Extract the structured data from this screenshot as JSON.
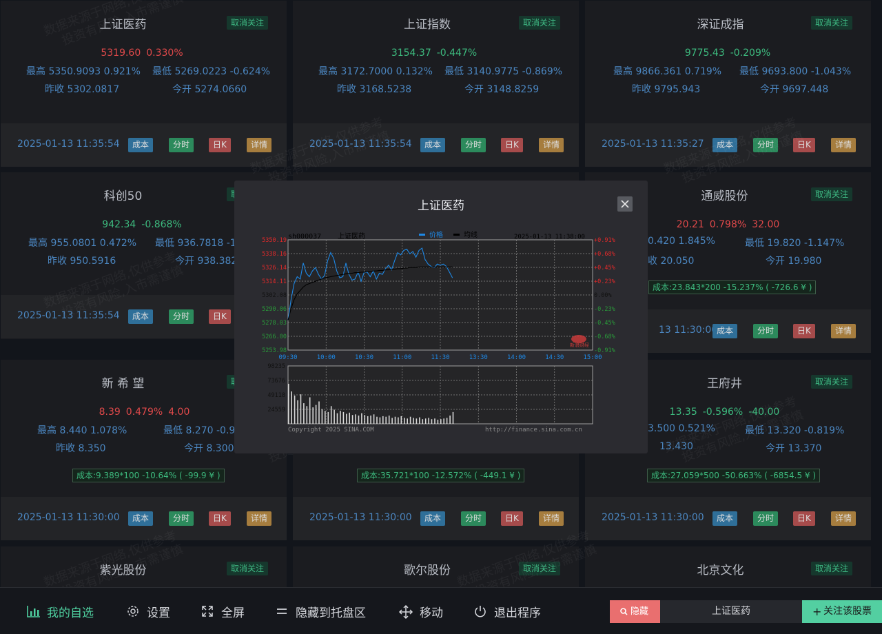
{
  "cards": [
    {
      "name": "上证医药",
      "action": "取消关注",
      "price": "5319.60",
      "pct": "0.330%",
      "extra": "",
      "dir": "up",
      "high": "最高 5350.9093 0.921%",
      "low": "最低 5269.0223 -0.624%",
      "prev": "昨收 5302.0817",
      "open": "今开 5274.0660",
      "cost": "",
      "time": "2025-01-13 11:35:54"
    },
    {
      "name": "上证指数",
      "action": "取消关注",
      "price": "3154.37",
      "pct": "-0.447%",
      "extra": "",
      "dir": "down",
      "high": "最高 3172.7000 0.132%",
      "low": "最低 3140.9775 -0.869%",
      "prev": "昨收 3168.5238",
      "open": "今开 3148.8259",
      "cost": "",
      "time": "2025-01-13 11:35:54"
    },
    {
      "name": "深证成指",
      "action": "取消关注",
      "price": "9775.43",
      "pct": "-0.209%",
      "extra": "",
      "dir": "down",
      "high": "最高 9866.361 0.719%",
      "low": "最低 9693.800 -1.043%",
      "prev": "昨收 9795.943",
      "open": "今开 9697.448",
      "cost": "",
      "time": "2025-01-13 11:35:27"
    },
    {
      "name": "科创50",
      "action": "取消关注",
      "price": "942.34",
      "pct": "-0.868%",
      "extra": "",
      "dir": "down",
      "high": "最高 955.0801 0.472%",
      "low": "最低 936.7818 -1.",
      "prev": "昨收 950.5916",
      "open": "今开 938.382",
      "cost": "",
      "time": "2025-01-13 11:35:54"
    },
    {
      "name": "通威股份",
      "action": "取消关注",
      "price": "20.21",
      "pct": "0.798%",
      "extra": "32.00",
      "dir": "up",
      "high": "0.420 1.845%",
      "low": "最低 19.820 -1.147%",
      "prev": "收 20.050",
      "open": "今开 19.980",
      "cost": "成本:23.843*200 -15.237% ( -726.6 ¥ )",
      "time": "13 11:30:00"
    },
    {
      "name": "新 希 望",
      "action": "取消关注",
      "price": "8.39",
      "pct": "0.479%",
      "extra": "4.00",
      "dir": "up",
      "high": "最高 8.440 1.078%",
      "low": "最低 8.270 -0.95",
      "prev": "昨收 8.350",
      "open": "今开 8.300",
      "cost": "成本:9.389*100 -10.64% ( -99.9 ¥ )",
      "time": "2025-01-13 11:30:00"
    },
    {
      "name": "",
      "action": "",
      "price": "",
      "pct": "",
      "extra": "",
      "dir": "up",
      "high": "",
      "low": "",
      "prev": "",
      "open": "",
      "cost": "成本:35.721*100 -12.572% ( -449.1 ¥ )",
      "time": "2025-01-13 11:30:00"
    },
    {
      "name": "王府井",
      "action": "取消关注",
      "price": "13.35",
      "pct": "-0.596%",
      "extra": "-40.00",
      "dir": "down",
      "high": "3.500 0.521%",
      "low": "最低 13.320 -0.819%",
      "prev": "13.430",
      "open": "今开 13.370",
      "cost": "成本:27.059*500 -50.663% ( -6854.5 ¥ )",
      "time": "2025-01-13 11:30:00"
    },
    {
      "name": "紫光股份",
      "action": "取消关注"
    },
    {
      "name": "歌尔股份",
      "action": "取消关注"
    },
    {
      "name": "北京文化",
      "action": "取消关注"
    }
  ],
  "buttons": {
    "cost": "成本",
    "minute": "分时",
    "day": "日K",
    "detail": "详情"
  },
  "watermark": {
    "line1": "数据来源于网络,仅供参考",
    "line2": "投资有风险,入市需谨慎"
  },
  "modal": {
    "title": "上证医药",
    "code": "sh000037",
    "name": "上证医药",
    "legend_price": "价格",
    "legend_avg": "均线",
    "datetime": "2025-01-13 11:38:00",
    "copyright": "Copyright 2025 SINA.COM",
    "url": "http://finance.sina.com.cn",
    "logo": "新浪财经"
  },
  "chart_data": {
    "type": "line",
    "title": "上证医药",
    "y_labels_left": [
      "5350.19",
      "5338.16",
      "5326.14",
      "5314.11",
      "5302.08",
      "5290.06",
      "5278.03",
      "5266.00",
      "5253.98"
    ],
    "y_labels_right": [
      "+0.91%",
      "+0.68%",
      "+0.45%",
      "+0.23%",
      "0.00%",
      "-0.23%",
      "-0.45%",
      "-0.68%",
      "-0.91%"
    ],
    "ylim": [
      5253.98,
      5350.19
    ],
    "x_labels": [
      "09:30",
      "10:00",
      "10:30",
      "11:00",
      "11:30",
      "13:30",
      "14:00",
      "14:30",
      "15:00"
    ],
    "series": [
      {
        "name": "价格",
        "color": "#1e88e5",
        "values": [
          5280,
          5298,
          5312,
          5318,
          5316,
          5330,
          5321,
          5318,
          5323,
          5326,
          5320,
          5316,
          5319,
          5332,
          5339,
          5334,
          5323,
          5317,
          5318,
          5330,
          5320,
          5315,
          5316,
          5322,
          5314,
          5322,
          5322,
          5318,
          5323,
          5316,
          5321,
          5320,
          5325,
          5328,
          5324,
          5332,
          5339,
          5337,
          5341,
          5342,
          5338,
          5340,
          5335,
          5341,
          5343,
          5333,
          5329,
          5327,
          5326,
          5329,
          5328,
          5329,
          5327,
          5322,
          5317
        ]
      },
      {
        "name": "均线",
        "color": "#000000",
        "values": [
          5280,
          5290,
          5298,
          5303,
          5306,
          5309,
          5311,
          5312,
          5313,
          5314,
          5315,
          5316,
          5317,
          5317.5,
          5318,
          5318.5,
          5319,
          5319.5,
          5320,
          5320.5,
          5321,
          5321,
          5321.5,
          5321.5,
          5322,
          5322,
          5322.5,
          5322.5,
          5323,
          5323,
          5323.5,
          5323.5,
          5324,
          5324,
          5324.5,
          5324.5,
          5325,
          5325,
          5325.5,
          5325.5,
          5326,
          5326,
          5326,
          5326.5,
          5326.5,
          5326.5,
          5326.5,
          5326.5,
          5326.5,
          5326.5,
          5326.5,
          5326.5,
          5326.5,
          5326.5,
          5326.5
        ]
      }
    ],
    "volume": {
      "labels": [
        "98235",
        "73676",
        "49118",
        "24559"
      ],
      "max": 98235,
      "values": [
        68000,
        55000,
        48000,
        40000,
        50000,
        35000,
        30000,
        45000,
        28000,
        32000,
        38000,
        25000,
        22000,
        20000,
        30000,
        24000,
        18000,
        22000,
        20000,
        17000,
        19000,
        15000,
        16000,
        14000,
        18000,
        15000,
        13000,
        14000,
        16000,
        12000,
        11000,
        13000,
        12000,
        14000,
        10000,
        12000,
        11000,
        13000,
        10000,
        9000,
        12000,
        10000,
        9000,
        11000,
        8000,
        9000,
        10000,
        8000,
        9000,
        7000,
        8000,
        9000,
        10000,
        14000,
        20000
      ]
    }
  },
  "bottom": {
    "nav": [
      "我的自选",
      "设置",
      "全屏",
      "隐藏到托盘区",
      "移动",
      "退出程序"
    ],
    "hide_label": "隐藏",
    "search_value": "上证医药",
    "follow_label": "关注该股票"
  },
  "colors": {
    "up": "#e0494a",
    "down": "#3dba7e",
    "accent": "#53cfa1",
    "hide": "#e96f6f"
  }
}
